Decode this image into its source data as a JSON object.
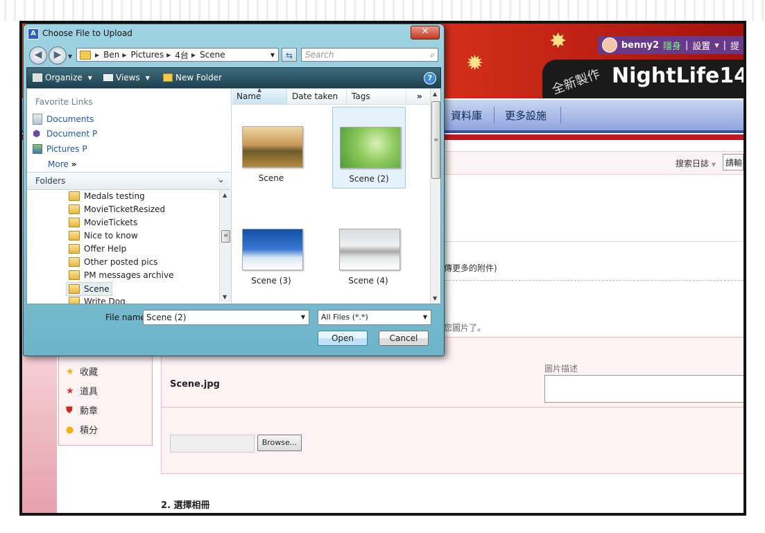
{
  "background_page": {
    "user_bar": {
      "username": "benny2",
      "status": "隱身",
      "settings": "設置",
      "extra": "提"
    },
    "logo": {
      "subtitle": "全新製作",
      "title": "NightLife14"
    },
    "nav": {
      "items": [
        "資料庫",
        "更多設施"
      ]
    },
    "search": {
      "label": "搜索日誌",
      "placeholder": "請輸"
    },
    "attach_note": "傳更多的附件)",
    "pic_note": "您圖片了。",
    "upload": {
      "file_name": "Scene.jpg",
      "desc_label": "圖片描述",
      "browse_label": "Browse..."
    },
    "side_menu": [
      {
        "label": "收藏",
        "icon": "star-icon"
      },
      {
        "label": "道具",
        "icon": "tool-star-icon"
      },
      {
        "label": "勳章",
        "icon": "medal-icon"
      },
      {
        "label": "積分",
        "icon": "coin-icon"
      }
    ],
    "section2": "2. 選擇相冊"
  },
  "dialog": {
    "title": "Choose File to Upload",
    "close_glyph": "✕",
    "address": {
      "crumbs": [
        "Ben",
        "Pictures",
        "4台",
        "Scene"
      ]
    },
    "search_placeholder": "Search",
    "toolbar": {
      "organize": "Organize",
      "views": "Views",
      "new_folder": "New Folder",
      "help": "?"
    },
    "favorites": {
      "heading": "Favorite Links",
      "items": [
        {
          "label": "Documents",
          "icon": "documents-icon"
        },
        {
          "label": "Document P",
          "icon": "document-p-icon"
        },
        {
          "label": "Pictures P",
          "icon": "pictures-icon"
        }
      ],
      "more": "More"
    },
    "folders_heading": "Folders",
    "tree": [
      {
        "label": "Medals testing",
        "selected": false
      },
      {
        "label": "MovieTicketResized",
        "selected": false
      },
      {
        "label": "MovieTickets",
        "selected": false
      },
      {
        "label": "Nice to know",
        "selected": false
      },
      {
        "label": "Offer Help",
        "selected": false
      },
      {
        "label": "Other posted pics",
        "selected": false
      },
      {
        "label": "PM messages archive",
        "selected": false
      },
      {
        "label": "Scene",
        "selected": true
      },
      {
        "label": "Write Dog",
        "selected": false
      }
    ],
    "columns": [
      "Name",
      "Date taken",
      "Tags"
    ],
    "files": [
      {
        "label": "Scene",
        "selected": false,
        "art": "windmill-photo"
      },
      {
        "label": "Scene (2)",
        "selected": true,
        "art": "green-leaves-photo"
      },
      {
        "label": "Scene (3)",
        "selected": false,
        "art": "snowy-trees-photo"
      },
      {
        "label": "Scene (4)",
        "selected": false,
        "art": "cannon-snow-photo"
      }
    ],
    "filename_label": "File name:",
    "filename_value": "Scene (2)",
    "filetype_value": "All Files (*.*)",
    "open_label": "Open",
    "cancel_label": "Cancel"
  }
}
